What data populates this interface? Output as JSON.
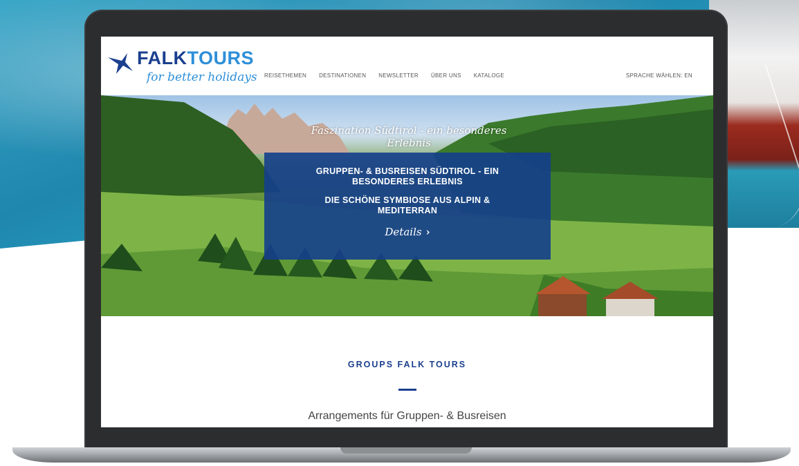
{
  "brand": {
    "name_part1": "FALK",
    "name_part2": "TOURS",
    "tagline": "for better holidays"
  },
  "nav": {
    "items": [
      {
        "label": "REISETHEMEN"
      },
      {
        "label": "DESTINATIONEN"
      },
      {
        "label": "NEWSLETTER"
      },
      {
        "label": "ÜBER UNS"
      },
      {
        "label": "KATALOGE"
      }
    ],
    "language": "SPRACHE WÄHLEN: EN"
  },
  "hero": {
    "script_title": "Faszination Südtirol - ein besonderes Erlebnis",
    "headline": "GRUPPEN- & BUSREISEN SÜDTIROL - EIN BESONDERES ERLEBNIS",
    "subheadline": "DIE SCHÖNE SYMBIOSE AUS ALPIN & MEDITERRAN",
    "details_label": "Details",
    "details_icon": "chevron-right-icon"
  },
  "section": {
    "title": "GROUPS FALK TOURS",
    "subtitle": "Arrangements für Gruppen- & Busreisen"
  },
  "colors": {
    "brand_navy": "#1b3f8f",
    "brand_light_blue": "#2e8fd8",
    "hero_box": "#153f8c"
  }
}
